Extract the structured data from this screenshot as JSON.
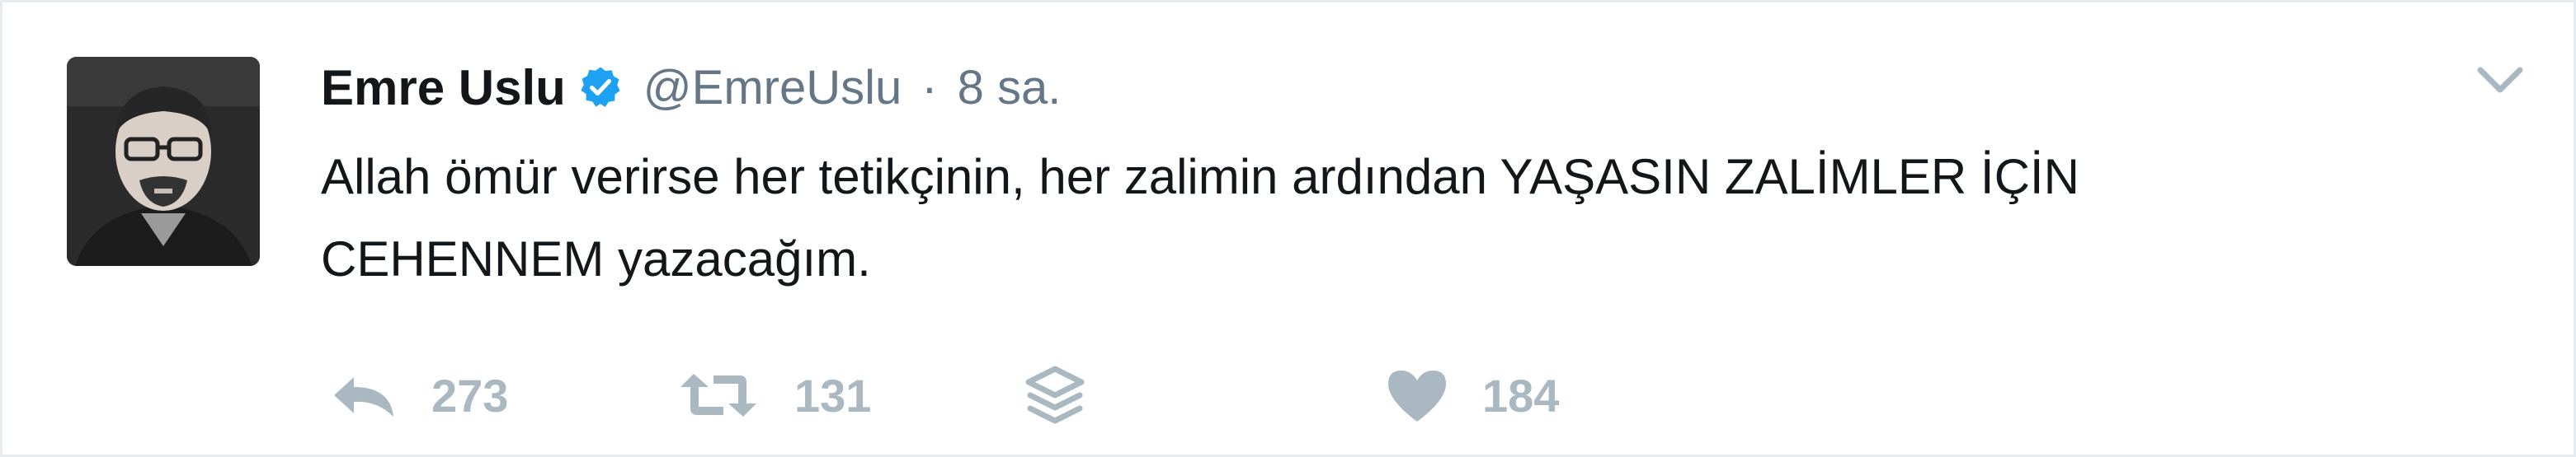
{
  "tweet": {
    "author_name": "Emre Uslu",
    "handle": "@EmreUslu",
    "separator": "·",
    "time": "8 sa.",
    "text_line_1": "Allah ömür verirse her tetikçinin, her zalimin ardından YAŞASIN ZALİMLER İÇİN",
    "text_line_2": "CEHENNEM yazacağım."
  },
  "actions": {
    "reply_count": "273",
    "retweet_count": "131",
    "like_count": "184"
  },
  "icons": {
    "verified": "verified-badge-icon",
    "caret": "chevron-down-icon",
    "reply": "reply-icon",
    "retweet": "retweet-icon",
    "stack": "layers-icon",
    "like": "heart-icon"
  },
  "colors": {
    "name": "#14171a",
    "muted": "#657786",
    "action_gray": "#aab8c2",
    "verified_blue": "#1da1f2",
    "border": "#e6ecf0"
  }
}
